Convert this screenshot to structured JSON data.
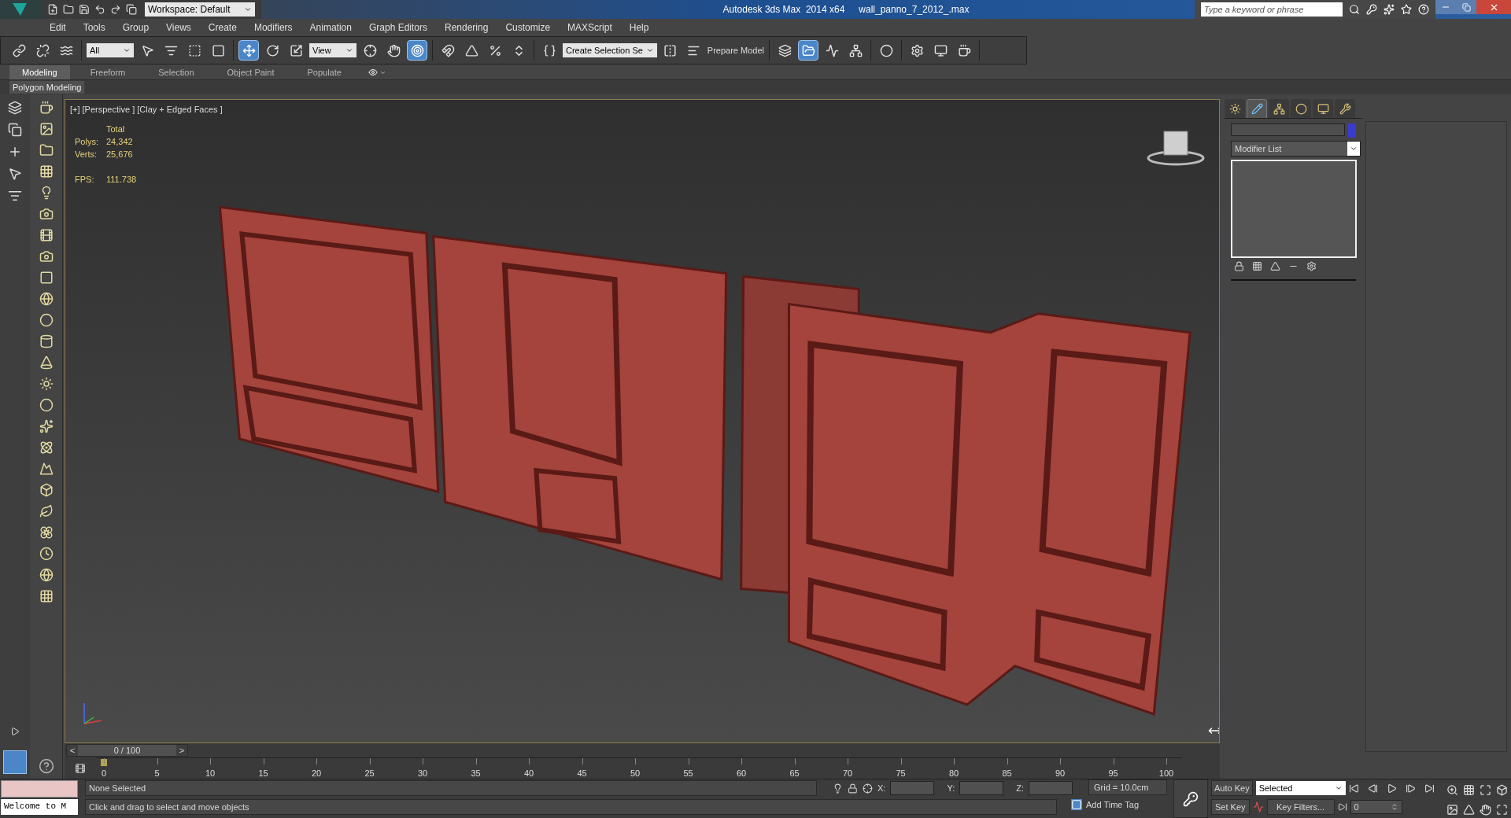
{
  "title_bar": {
    "workspace": "Workspace: Default",
    "app_title": "Autodesk 3ds Max  2014 x64",
    "file_name": "wall_panno_7_2012_.max",
    "search": {
      "placeholder": "Type a keyword or phrase"
    }
  },
  "menu": [
    "Edit",
    "Tools",
    "Group",
    "Views",
    "Create",
    "Modifiers",
    "Animation",
    "Graph Editors",
    "Rendering",
    "Customize",
    "MAXScript",
    "Help"
  ],
  "main_toolbar": [
    [
      {
        "kind": "link",
        "selected": false
      },
      {
        "kind": "unlink",
        "selected": false
      },
      {
        "kind": "bind",
        "selected": false
      }
    ],
    [
      {
        "kind": "dropdown",
        "value": "All"
      },
      {
        "kind": "select",
        "selected": false
      },
      {
        "kind": "select-by-name",
        "selected": false
      },
      {
        "kind": "region",
        "selected": false
      },
      {
        "kind": "crossing",
        "selected": false
      }
    ],
    [
      {
        "kind": "move",
        "selected": true
      },
      {
        "kind": "rotate",
        "selected": false
      },
      {
        "kind": "scale",
        "selected": false
      },
      {
        "kind": "dropdown",
        "value": "View"
      },
      {
        "kind": "pivot",
        "selected": false
      },
      {
        "kind": "manipulate",
        "selected": false
      },
      {
        "kind": "place",
        "selected": true
      }
    ],
    [
      {
        "kind": "snap",
        "selected": false
      },
      {
        "kind": "angle-snap",
        "selected": false
      },
      {
        "kind": "percent-snap",
        "selected": false
      },
      {
        "kind": "spinner-snap",
        "selected": false
      }
    ],
    [
      {
        "kind": "named-sets",
        "selected": false
      },
      {
        "kind": "dropdown",
        "value": "Create Selection Se"
      },
      {
        "kind": "mirror",
        "selected": false
      },
      {
        "kind": "align",
        "selected": false
      },
      {
        "kind": "text",
        "value": "Prepare Model"
      }
    ],
    [
      {
        "kind": "layers",
        "selected": false
      },
      {
        "kind": "explorer",
        "selected": true
      },
      {
        "kind": "curve-editor",
        "selected": false
      },
      {
        "kind": "schematic",
        "selected": false
      }
    ],
    [
      {
        "kind": "material",
        "selected": false
      }
    ],
    [
      {
        "kind": "render-setup",
        "selected": false
      },
      {
        "kind": "frame-window",
        "selected": false
      },
      {
        "kind": "render",
        "selected": false
      }
    ]
  ],
  "ribbon_tabs": [
    {
      "label": "Modeling",
      "selected": true
    },
    {
      "label": "Freeform",
      "selected": false
    },
    {
      "label": "Selection",
      "selected": false
    },
    {
      "label": "Object Paint",
      "selected": false
    },
    {
      "label": "Populate",
      "selected": false
    }
  ],
  "ribbon_panel": "Polygon Modeling",
  "viewport": {
    "labels": [
      "[+]",
      "[Perspective ]",
      "[Clay + Edged Faces ]"
    ],
    "stats": {
      "heading": "Total",
      "rows": [
        {
          "label": "Polys:",
          "value": "24,342"
        },
        {
          "label": "Verts:",
          "value": "25,676"
        }
      ],
      "fps_label": "FPS:",
      "fps_value": "111.738"
    }
  },
  "command_panel": {
    "tabs": [
      {
        "kind": "create",
        "selected": false
      },
      {
        "kind": "modify",
        "selected": true
      },
      {
        "kind": "hierarchy",
        "selected": false
      },
      {
        "kind": "motion",
        "selected": false
      },
      {
        "kind": "display",
        "selected": false
      },
      {
        "kind": "utilities",
        "selected": false
      }
    ],
    "modifier_list": "Modifier List"
  },
  "time_slider": {
    "prev": "<",
    "position": "0 / 100",
    "next": ">",
    "level": 0
  },
  "track_labels": [
    "0",
    "5",
    "10",
    "15",
    "20",
    "25",
    "30",
    "35",
    "40",
    "45",
    "50",
    "55",
    "60",
    "65",
    "70",
    "75",
    "80",
    "85",
    "90",
    "95",
    "100"
  ],
  "status": {
    "listener": "Welcome to M",
    "selection": "None Selected",
    "prompt": "Click and drag to select and move objects",
    "x_label": "X:",
    "y_label": "Y:",
    "z_label": "Z:",
    "grid": "Grid = 10.0cm",
    "time_tag": "Add Time Tag",
    "auto_key": "Auto Key",
    "set_key": "Set Key",
    "key_mode": "Selected",
    "key_filters": "Key Filters...",
    "frame": "0"
  }
}
